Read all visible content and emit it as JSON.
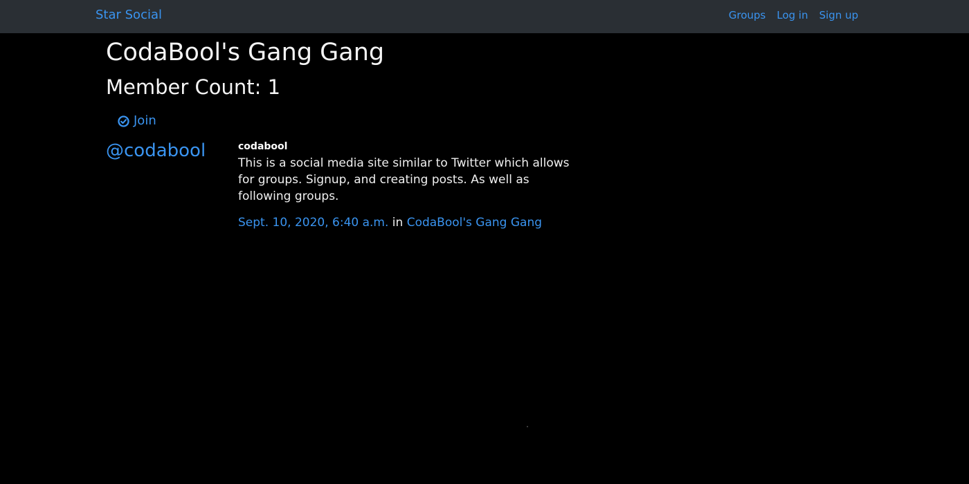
{
  "navbar": {
    "brand": "Star Social",
    "links": [
      "Groups",
      "Log in",
      "Sign up"
    ]
  },
  "group": {
    "title": "CodaBool's Gang Gang",
    "member_count": "Member Count: 1",
    "join_label": "Join"
  },
  "post": {
    "author_handle": "@codabool",
    "username": "codabool",
    "message": "This is a social media site similar to Twitter which allows for groups. Signup, and creating posts. As well as following groups.",
    "timestamp": "Sept. 10, 2020, 6:40 a.m.",
    "in_word": "in",
    "group_link": "CodaBool's Gang Gang"
  },
  "colors": {
    "background": "#000000",
    "navbar": "#2a2f34",
    "link": "#3a94f0",
    "text": "#f4f4f4"
  },
  "icons": {
    "join": "check-circle-icon"
  }
}
